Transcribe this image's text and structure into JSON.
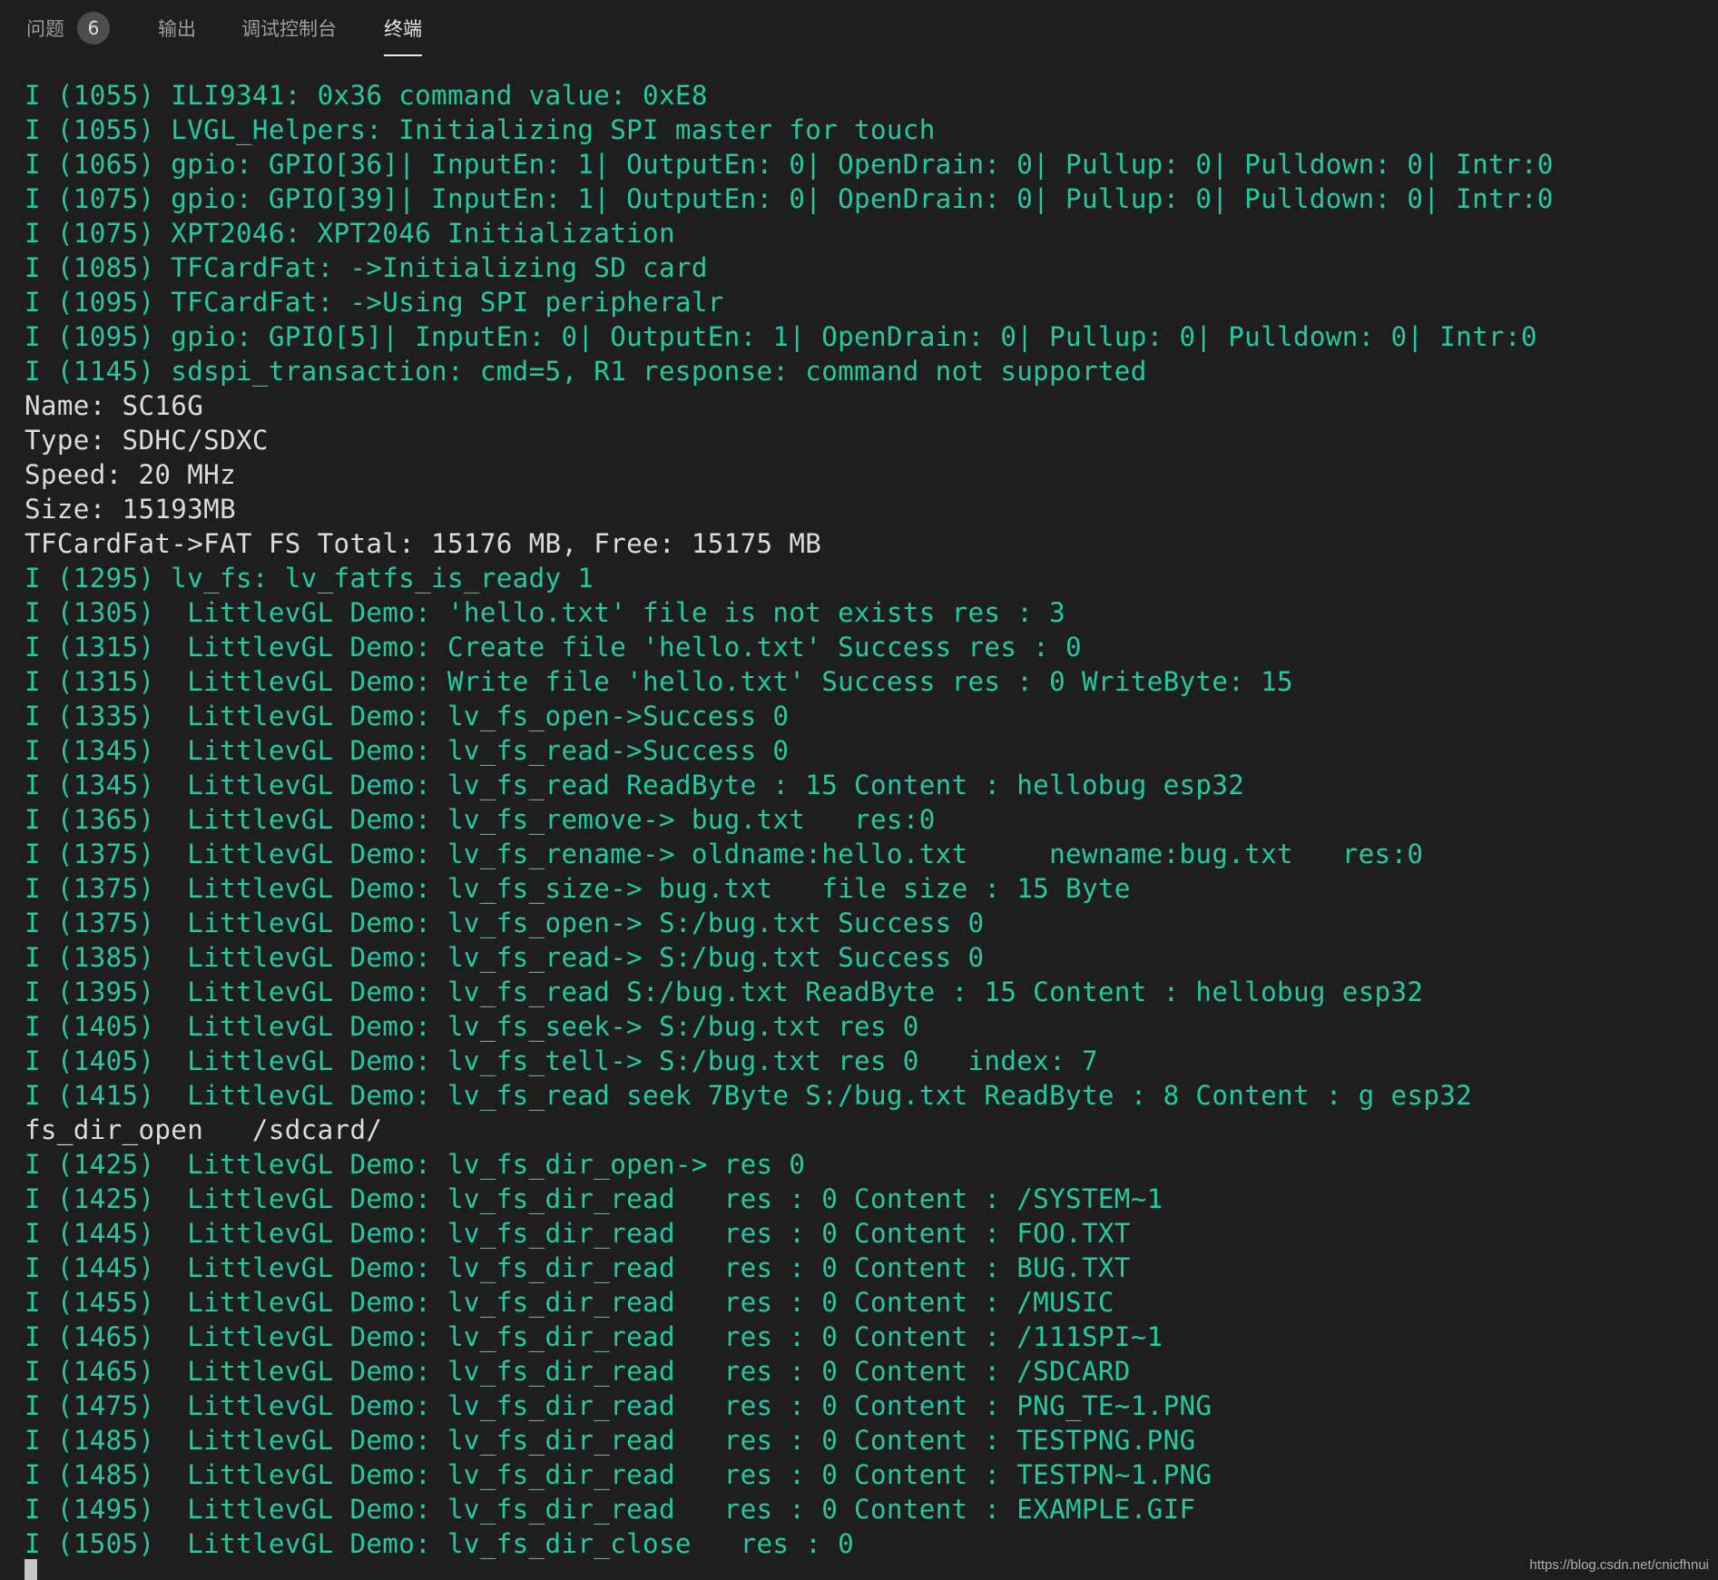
{
  "tabs": [
    {
      "label": "问题",
      "badge": "6"
    },
    {
      "label": "输出"
    },
    {
      "label": "调试控制台"
    },
    {
      "label": "终端",
      "active": true
    }
  ],
  "colors": {
    "background": "#1e1e1e",
    "info_text": "#23c9a0",
    "plain_text": "#dcdcdc"
  },
  "terminal": {
    "lines": [
      {
        "type": "info",
        "text": "I (1055) ILI9341: 0x36 command value: 0xE8"
      },
      {
        "type": "info",
        "text": "I (1055) LVGL_Helpers: Initializing SPI master for touch"
      },
      {
        "type": "info",
        "text": "I (1065) gpio: GPIO[36]| InputEn: 1| OutputEn: 0| OpenDrain: 0| Pullup: 0| Pulldown: 0| Intr:0"
      },
      {
        "type": "info",
        "text": "I (1075) gpio: GPIO[39]| InputEn: 1| OutputEn: 0| OpenDrain: 0| Pullup: 0| Pulldown: 0| Intr:0"
      },
      {
        "type": "info",
        "text": "I (1075) XPT2046: XPT2046 Initialization"
      },
      {
        "type": "info",
        "text": "I (1085) TFCardFat: ->Initializing SD card"
      },
      {
        "type": "info",
        "text": "I (1095) TFCardFat: ->Using SPI peripheralr"
      },
      {
        "type": "info",
        "text": "I (1095) gpio: GPIO[5]| InputEn: 0| OutputEn: 1| OpenDrain: 0| Pullup: 0| Pulldown: 0| Intr:0"
      },
      {
        "type": "info",
        "text": "I (1145) sdspi_transaction: cmd=5, R1 response: command not supported"
      },
      {
        "type": "plain",
        "text": "Name: SC16G"
      },
      {
        "type": "plain",
        "text": "Type: SDHC/SDXC"
      },
      {
        "type": "plain",
        "text": "Speed: 20 MHz"
      },
      {
        "type": "plain",
        "text": "Size: 15193MB"
      },
      {
        "type": "plain",
        "text": "TFCardFat->FAT FS Total: 15176 MB, Free: 15175 MB"
      },
      {
        "type": "info",
        "text": "I (1295) lv_fs: lv_fatfs_is_ready 1"
      },
      {
        "type": "info",
        "text": "I (1305)  LittlevGL Demo: 'hello.txt' file is not exists res : 3"
      },
      {
        "type": "info",
        "text": "I (1315)  LittlevGL Demo: Create file 'hello.txt' Success res : 0"
      },
      {
        "type": "info",
        "text": "I (1315)  LittlevGL Demo: Write file 'hello.txt' Success res : 0 WriteByte: 15"
      },
      {
        "type": "info",
        "text": "I (1335)  LittlevGL Demo: lv_fs_open->Success 0"
      },
      {
        "type": "info",
        "text": "I (1345)  LittlevGL Demo: lv_fs_read->Success 0"
      },
      {
        "type": "info",
        "text": "I (1345)  LittlevGL Demo: lv_fs_read ReadByte : 15 Content : hellobug esp32"
      },
      {
        "type": "info",
        "text": "I (1365)  LittlevGL Demo: lv_fs_remove-> bug.txt   res:0"
      },
      {
        "type": "info",
        "text": "I (1375)  LittlevGL Demo: lv_fs_rename-> oldname:hello.txt     newname:bug.txt   res:0"
      },
      {
        "type": "info",
        "text": "I (1375)  LittlevGL Demo: lv_fs_size-> bug.txt   file size : 15 Byte"
      },
      {
        "type": "info",
        "text": "I (1375)  LittlevGL Demo: lv_fs_open-> S:/bug.txt Success 0"
      },
      {
        "type": "info",
        "text": "I (1385)  LittlevGL Demo: lv_fs_read-> S:/bug.txt Success 0"
      },
      {
        "type": "info",
        "text": "I (1395)  LittlevGL Demo: lv_fs_read S:/bug.txt ReadByte : 15 Content : hellobug esp32"
      },
      {
        "type": "info",
        "text": "I (1405)  LittlevGL Demo: lv_fs_seek-> S:/bug.txt res 0"
      },
      {
        "type": "info",
        "text": "I (1405)  LittlevGL Demo: lv_fs_tell-> S:/bug.txt res 0   index: 7"
      },
      {
        "type": "info",
        "text": "I (1415)  LittlevGL Demo: lv_fs_read seek 7Byte S:/bug.txt ReadByte : 8 Content : g esp32"
      },
      {
        "type": "plain",
        "text": "fs_dir_open   /sdcard/"
      },
      {
        "type": "info",
        "text": "I (1425)  LittlevGL Demo: lv_fs_dir_open-> res 0"
      },
      {
        "type": "info",
        "text": "I (1425)  LittlevGL Demo: lv_fs_dir_read   res : 0 Content : /SYSTEM~1"
      },
      {
        "type": "info",
        "text": "I (1445)  LittlevGL Demo: lv_fs_dir_read   res : 0 Content : FOO.TXT"
      },
      {
        "type": "info",
        "text": "I (1445)  LittlevGL Demo: lv_fs_dir_read   res : 0 Content : BUG.TXT"
      },
      {
        "type": "info",
        "text": "I (1455)  LittlevGL Demo: lv_fs_dir_read   res : 0 Content : /MUSIC"
      },
      {
        "type": "info",
        "text": "I (1465)  LittlevGL Demo: lv_fs_dir_read   res : 0 Content : /111SPI~1"
      },
      {
        "type": "info",
        "text": "I (1465)  LittlevGL Demo: lv_fs_dir_read   res : 0 Content : /SDCARD"
      },
      {
        "type": "info",
        "text": "I (1475)  LittlevGL Demo: lv_fs_dir_read   res : 0 Content : PNG_TE~1.PNG"
      },
      {
        "type": "info",
        "text": "I (1485)  LittlevGL Demo: lv_fs_dir_read   res : 0 Content : TESTPNG.PNG"
      },
      {
        "type": "info",
        "text": "I (1485)  LittlevGL Demo: lv_fs_dir_read   res : 0 Content : TESTPN~1.PNG"
      },
      {
        "type": "info",
        "text": "I (1495)  LittlevGL Demo: lv_fs_dir_read   res : 0 Content : EXAMPLE.GIF"
      },
      {
        "type": "info",
        "text": "I (1505)  LittlevGL Demo: lv_fs_dir_close   res : 0"
      }
    ]
  },
  "watermark": "https://blog.csdn.net/cnicfhnui"
}
